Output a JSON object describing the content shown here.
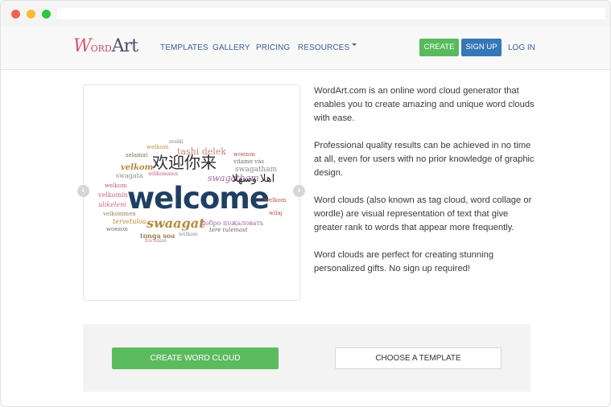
{
  "browser": {},
  "logo": {
    "w": "W",
    "ord": "ord",
    "art": "Art"
  },
  "nav": {
    "links": [
      "TEMPLATES",
      "GALLERY",
      "PRICING",
      "RESOURCES"
    ],
    "create": "CREATE",
    "signup": "SIGN UP",
    "login": "LOG IN"
  },
  "carousel": {
    "words": {
      "welcome_big": "welcome",
      "chinese": "欢迎你来",
      "swaagat": "swaagat",
      "tashi": "tashi delek",
      "velkom": "velkom",
      "arabic": "اهلا وسهلا",
      "swagatham": "swagatham",
      "swagatham2": "swagatham",
      "dobro": "добро пожаловать",
      "tervetuloa": "tervetuloa",
      "tongasoa": "tonga soa",
      "vitame": "vitame vás",
      "welkomen": "velkommen",
      "willkommen": "willkommen",
      "welkom": "welkom",
      "sveiki": "sveiki",
      "wilaj": "wilaj",
      "welkom2": "welkom",
      "wozon": "woezon",
      "teretulemast": "tere tulemast",
      "velkomin": "velkomin",
      "ulikeleni": "ulikeleni",
      "selamat": "selamat",
      "swagata": "swagata",
      "fos": "fos ealas"
    }
  },
  "description": [
    "WordArt.com is an online word cloud generator that enables you to create amazing and unique word clouds with ease.",
    "Professional quality results can be achieved in no time at all, even for users with no prior knowledge of graphic design.",
    "Word clouds (also known as tag cloud, word collage or wordle) are visual representation of text that give greater rank to words that appear more frequently.",
    "Word clouds are perfect for creating stunning personalized gifts. No sign up required!"
  ],
  "cta": {
    "create_word_cloud": "CREATE WORD CLOUD",
    "choose_template": "CHOOSE A TEMPLATE"
  },
  "colors": {
    "green": "#58ba5c",
    "blue": "#3578b8",
    "link": "#3d5f95",
    "cloud_navy": "#1f3f63"
  }
}
